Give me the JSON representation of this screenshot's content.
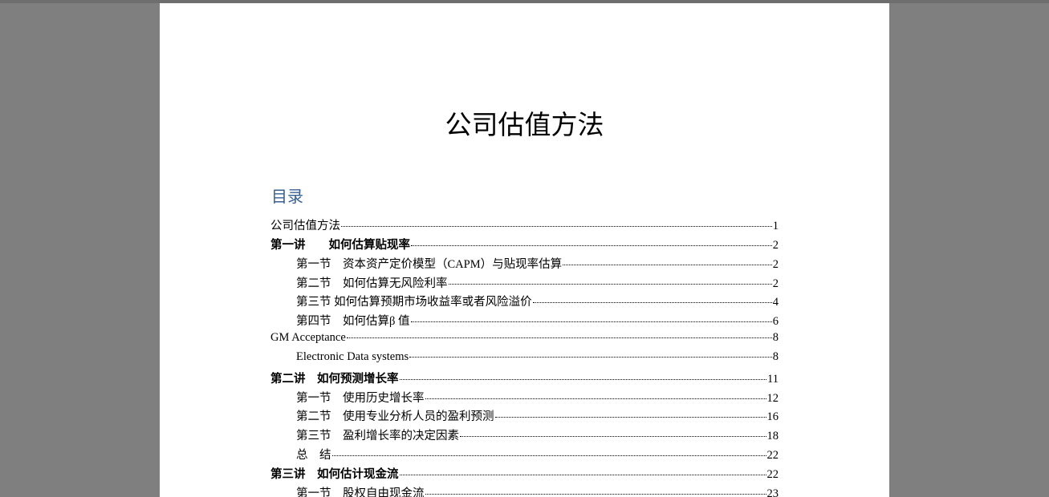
{
  "document": {
    "title": "公司估值方法"
  },
  "toc": {
    "heading": "目录",
    "entries": [
      {
        "text": "公司估值方法",
        "page": "1",
        "level": 1,
        "bold": false
      },
      {
        "text": "第一讲　　如何估算贴现率",
        "page": "2",
        "level": 1,
        "bold": true
      },
      {
        "text": "第一节　资本资产定价模型（CAPM）与贴现率估算",
        "page": "2",
        "level": 2,
        "bold": false
      },
      {
        "text": "第二节　如何估算无风险利率",
        "page": "2",
        "level": 2,
        "bold": false
      },
      {
        "text": "第三节 如何估算预期市场收益率或者风险溢价",
        "page": "4",
        "level": 2,
        "bold": false
      },
      {
        "text": "第四节　如何估算β 值",
        "page": "6",
        "level": 2,
        "bold": false
      },
      {
        "text": "GM Acceptance",
        "page": "8",
        "level": 1,
        "bold": false
      },
      {
        "text": "Electronic Data systems",
        "page": "8",
        "level": 2,
        "bold": false
      },
      {
        "text": "第二讲　如何预测增长率",
        "page": "11",
        "level": 1,
        "bold": true
      },
      {
        "text": "第一节　使用历史增长率",
        "page": "12",
        "level": 2,
        "bold": false
      },
      {
        "text": "第二节　使用专业分析人员的盈利预测",
        "page": "16",
        "level": 2,
        "bold": false
      },
      {
        "text": "第三节　盈利增长率的决定因素",
        "page": "18",
        "level": 2,
        "bold": false
      },
      {
        "text": "总　结",
        "page": "22",
        "level": 2,
        "bold": false
      },
      {
        "text": "第三讲　如何估计现金流",
        "page": "22",
        "level": 1,
        "bold": true
      },
      {
        "text": "第一节　股权自由现金流",
        "page": "23",
        "level": 2,
        "bold": false
      }
    ]
  }
}
